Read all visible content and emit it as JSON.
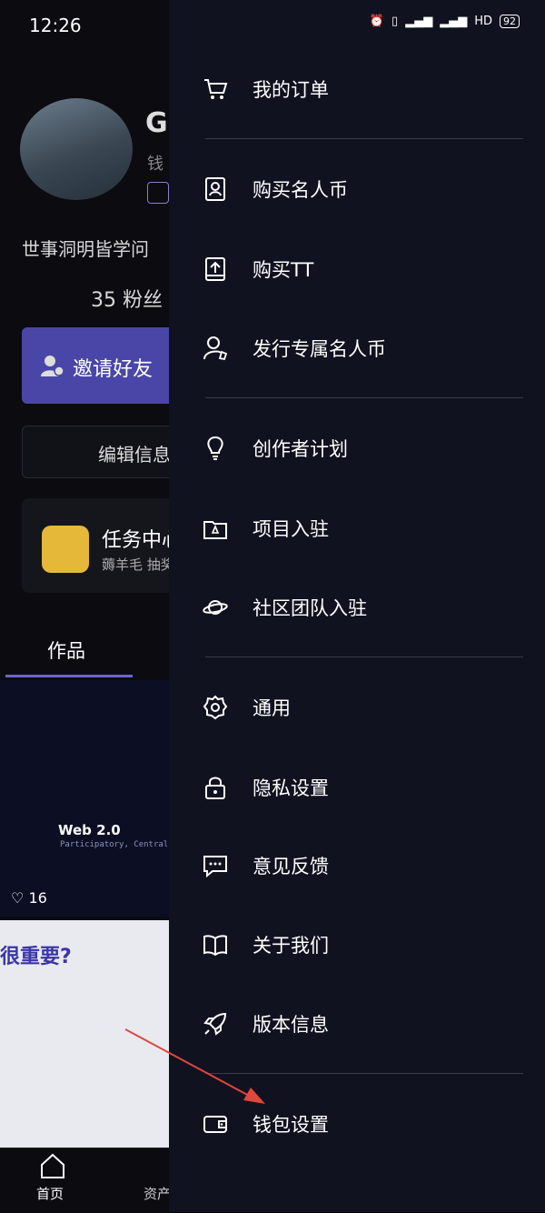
{
  "status": {
    "time": "12:26",
    "network": "HD",
    "battery": "92"
  },
  "profile": {
    "name_initial": "G",
    "sub_label": "钱",
    "bio": "世事洞明皆学问",
    "fans": "35 粉丝",
    "invite_label": "邀请好友",
    "edit_label": "编辑信息",
    "task_title": "任务中心",
    "task_sub": "薅羊毛 抽奖",
    "works_tab": "作品",
    "thumb_title": "Web 2.0",
    "thumb_sub": "Participatory, Centralized",
    "likes": "16",
    "article_title": "很重要?"
  },
  "tabbar": {
    "home": "首页",
    "assets": "资产"
  },
  "menu": {
    "items": [
      {
        "label": "我的订单",
        "icon": "cart-icon"
      },
      {
        "label": "购买名人币",
        "icon": "portrait-card-icon"
      },
      {
        "label": "购买TT",
        "icon": "upload-tray-icon"
      },
      {
        "label": "发行专属名人币",
        "icon": "user-shield-icon"
      },
      {
        "label": "创作者计划",
        "icon": "lightbulb-icon"
      },
      {
        "label": "项目入驻",
        "icon": "folder-rocket-icon"
      },
      {
        "label": "社区团队入驻",
        "icon": "planet-icon"
      },
      {
        "label": "通用",
        "icon": "gear-icon"
      },
      {
        "label": "隐私设置",
        "icon": "lock-icon"
      },
      {
        "label": "意见反馈",
        "icon": "chat-icon"
      },
      {
        "label": "关于我们",
        "icon": "book-icon"
      },
      {
        "label": "版本信息",
        "icon": "rocket-icon"
      },
      {
        "label": "钱包设置",
        "icon": "wallet-icon"
      }
    ]
  },
  "annotation_color": "#e0473e"
}
